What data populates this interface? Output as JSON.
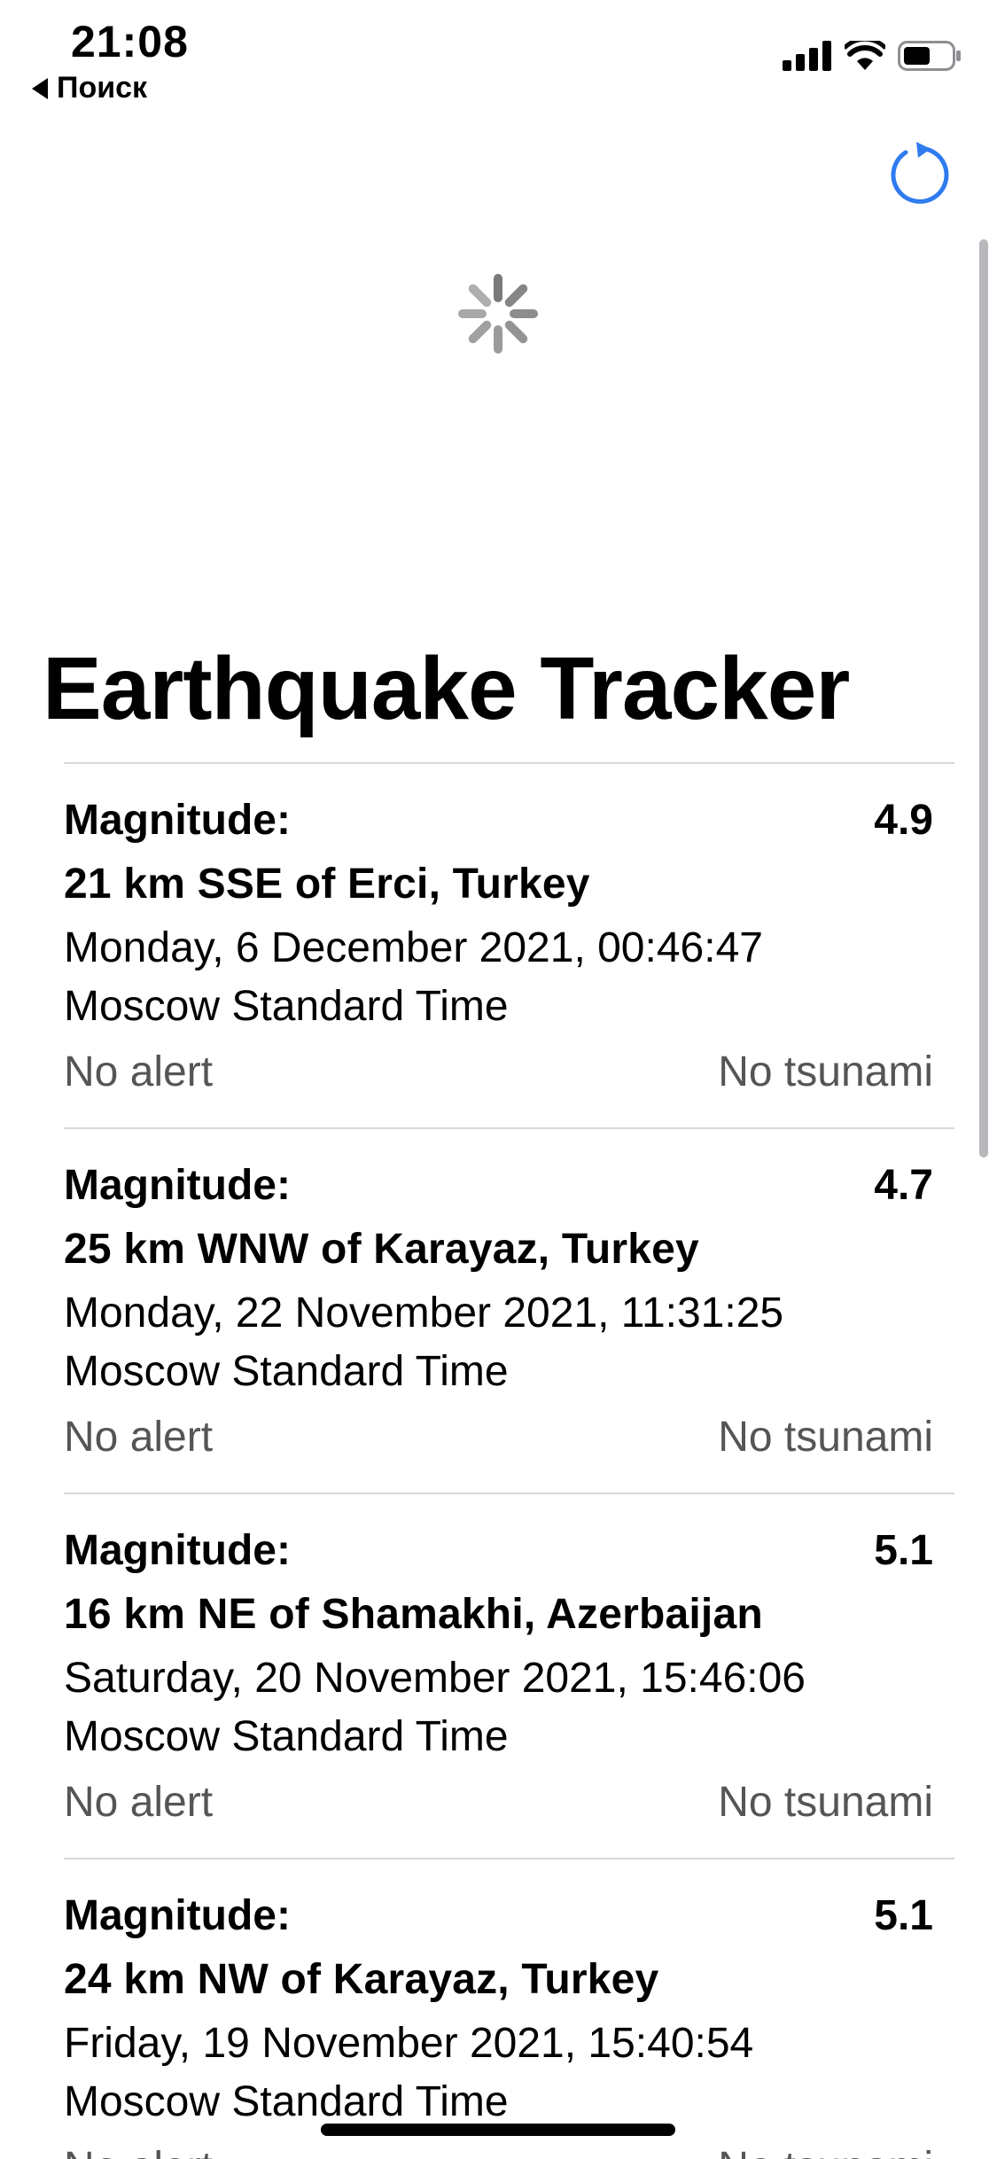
{
  "status_bar": {
    "time": "21:08",
    "back_label": "Поиск",
    "signal_icon": "cellular-signal-icon",
    "wifi_icon": "wifi-icon",
    "battery_icon": "battery-icon"
  },
  "header": {
    "refresh_icon": "refresh-icon",
    "loading_icon": "activity-spinner-icon",
    "title": "Earthquake Tracker"
  },
  "colors": {
    "accent": "#2f7bf0",
    "spinner": "#7a7a7a",
    "separator": "#d8d8dc",
    "secondary_text": "#555555"
  },
  "quakes": [
    {
      "magnitude_label": "Magnitude:",
      "magnitude": "4.9",
      "place": "21 km SSE of Erci, Turkey",
      "date": "Monday, 6 December 2021, 00:46:47",
      "timezone": "Moscow Standard Time",
      "alert": "No alert",
      "tsunami": "No tsunami"
    },
    {
      "magnitude_label": "Magnitude:",
      "magnitude": "4.7",
      "place": "25 km WNW of Karayaz, Turkey",
      "date": "Monday, 22 November 2021, 11:31:25",
      "timezone": "Moscow Standard Time",
      "alert": "No alert",
      "tsunami": "No tsunami"
    },
    {
      "magnitude_label": "Magnitude:",
      "magnitude": "5.1",
      "place": "16 km NE of Shamakhi, Azerbaijan",
      "date": "Saturday, 20 November 2021, 15:46:06",
      "timezone": "Moscow Standard Time",
      "alert": "No alert",
      "tsunami": "No tsunami"
    },
    {
      "magnitude_label": "Magnitude:",
      "magnitude": "5.1",
      "place": "24 km NW of Karayaz, Turkey",
      "date": "Friday, 19 November 2021, 15:40:54",
      "timezone": "Moscow Standard Time",
      "alert": "No alert",
      "tsunami": "No tsunami"
    }
  ]
}
